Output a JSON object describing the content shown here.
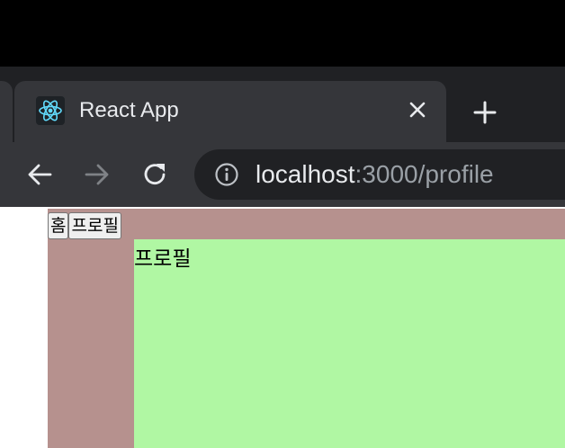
{
  "browser": {
    "tab": {
      "title": "React App"
    },
    "address_bar": {
      "host": "localhost",
      "path": ":3000/profile"
    }
  },
  "app": {
    "nav": {
      "home_label": "홈",
      "profile_label": "프로필"
    },
    "main": {
      "heading": "프로필"
    }
  },
  "colors": {
    "app_background": "#b6918e",
    "main_panel_background": "#b0f7a3"
  }
}
